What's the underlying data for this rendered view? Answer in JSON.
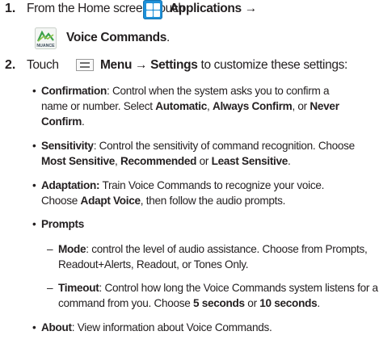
{
  "step1": {
    "number": "1.",
    "pre": "From the Home screen, touch",
    "applications": "Applications",
    "arrow": "→",
    "voice_commands": "Voice Commands",
    "trail": "."
  },
  "nuance_icon_text": "NUANCE",
  "step2": {
    "number": "2.",
    "touch": "Touch",
    "menu": "Menu",
    "arrow": "→",
    "settings": "Settings",
    "rest": "to customize these settings:"
  },
  "bullet_char": "•",
  "dash_char": "–",
  "confirmation": {
    "label": "Confirmation",
    "line1": ": Control when the system asks you to confirm a",
    "line2a": "name or number. Select ",
    "opt1": "Automatic",
    "sep1": ", ",
    "opt2": "Always Confirm",
    "sep2": ", or ",
    "opt3a": "Never",
    "opt3b": "Confirm",
    "end": "."
  },
  "sensitivity": {
    "label": "Sensitivity",
    "line1": ": Control the sensitivity of command recognition. Choose",
    "opt1": "Most Sensitive",
    "sep1": ", ",
    "opt2": "Recommended",
    "sep2": " or ",
    "opt3": "Least Sensitive",
    "end": "."
  },
  "adaptation": {
    "label": "Adaptation:",
    "line1": " Train Voice Commands to recognize your voice.",
    "line2a": "Choose ",
    "opt": "Adapt Voice",
    "line2b": ", then follow the audio prompts."
  },
  "prompts": {
    "label": "Prompts",
    "mode": {
      "label": "Mode",
      "line1": ": control the level of audio assistance.  Choose from Prompts,",
      "line2": "Readout+Alerts, Readout, or Tones Only."
    },
    "timeout": {
      "label": "Timeout",
      "line1": ": Control how long the Voice Commands system listens for a",
      "line2a": "command from you. Choose ",
      "opt1": "5 seconds",
      "sep": " or ",
      "opt2": "10 seconds",
      "end": "."
    }
  },
  "about": {
    "label": "About",
    "line1": ": View information about Voice Commands."
  }
}
